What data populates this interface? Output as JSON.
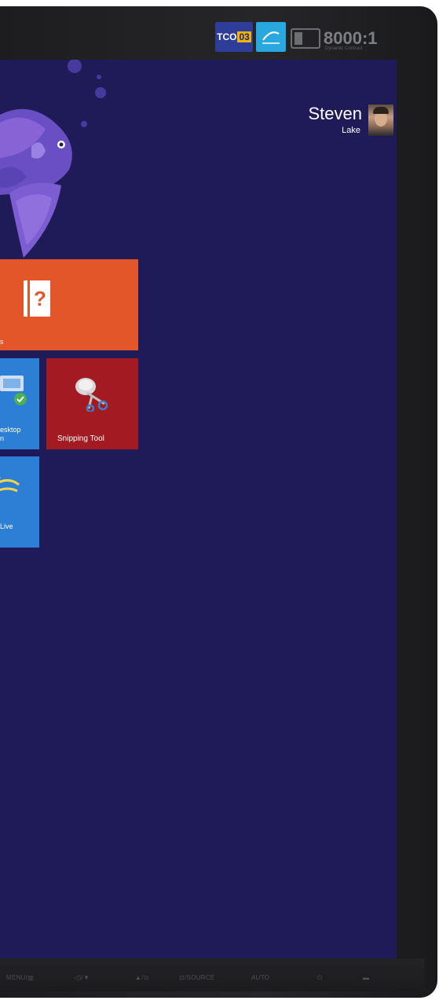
{
  "badges": {
    "tco_label": "TCO",
    "tco_number": "03",
    "contrast_ratio": "8000:1",
    "contrast_sub": "Dynamic Contrast"
  },
  "user": {
    "name": "Steven",
    "subtitle": "Lake"
  },
  "tiles": {
    "help_label": "s",
    "rdc_label": "esktop\nn",
    "snipping_label": "Snipping Tool",
    "live_label": "Live"
  },
  "monitor_buttons": {
    "menu": "MENU/▥",
    "volume": "◁)/▼",
    "up": "▲/⊙",
    "source": "⊡/SOURCE",
    "auto": "AUTO",
    "power": "⏻",
    "led": "▬"
  },
  "colors": {
    "screen": "#1f1a58",
    "help_tile": "#e2562a",
    "blue_tile": "#2d7fd5",
    "snipping_tile": "#a31a22"
  },
  "icons": {
    "help": "help-book-icon",
    "rdc": "remote-desktop-icon",
    "snipping": "scissors-icon",
    "live": "live-swirl-icon"
  }
}
